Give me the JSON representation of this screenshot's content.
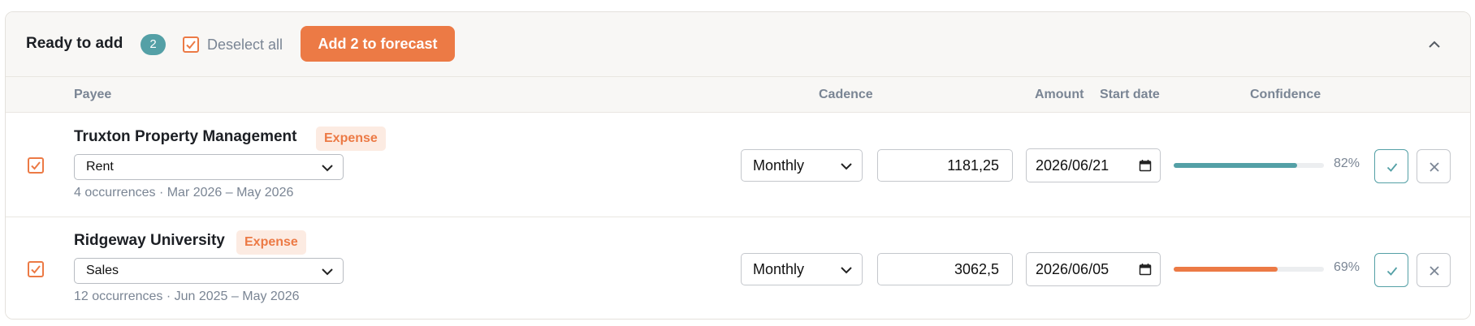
{
  "header": {
    "title": "Ready to add",
    "count": "2",
    "deselect_label": "Deselect all",
    "add_button_label": "Add 2 to forecast"
  },
  "columns": {
    "payee": "Payee",
    "cadence": "Cadence",
    "amount": "Amount",
    "start_date": "Start date",
    "confidence": "Confidence"
  },
  "rows": [
    {
      "checked": true,
      "payee": "Truxton Property Management",
      "type": "Expense",
      "category": "Rent",
      "occurrences": "4 occurrences · Mar 2026 – May 2026",
      "cadence": "Monthly",
      "amount": "1181,25",
      "start_date": "2026/06/21",
      "confidence": 0.82,
      "confidence_label": "82%",
      "confidence_color": "#54a0a6"
    },
    {
      "checked": true,
      "payee": "Ridgeway University",
      "type": "Expense",
      "category": "Sales",
      "occurrences": "12 occurrences · Jun 2025 – May 2026",
      "cadence": "Monthly",
      "amount": "3062,5",
      "start_date": "2026/06/05",
      "confidence": 0.69,
      "confidence_label": "69%",
      "confidence_color": "#ec7a45"
    }
  ],
  "colors": {
    "accent": "#ec7a45",
    "teal": "#54a0a6",
    "muted_text": "#7a8594"
  },
  "icons": {
    "checkbox": "checked-checkbox-icon",
    "collapse": "chevron-up-icon",
    "dropdown": "chevron-down-icon",
    "calendar": "calendar-icon",
    "accept": "check-icon",
    "reject": "close-icon"
  }
}
